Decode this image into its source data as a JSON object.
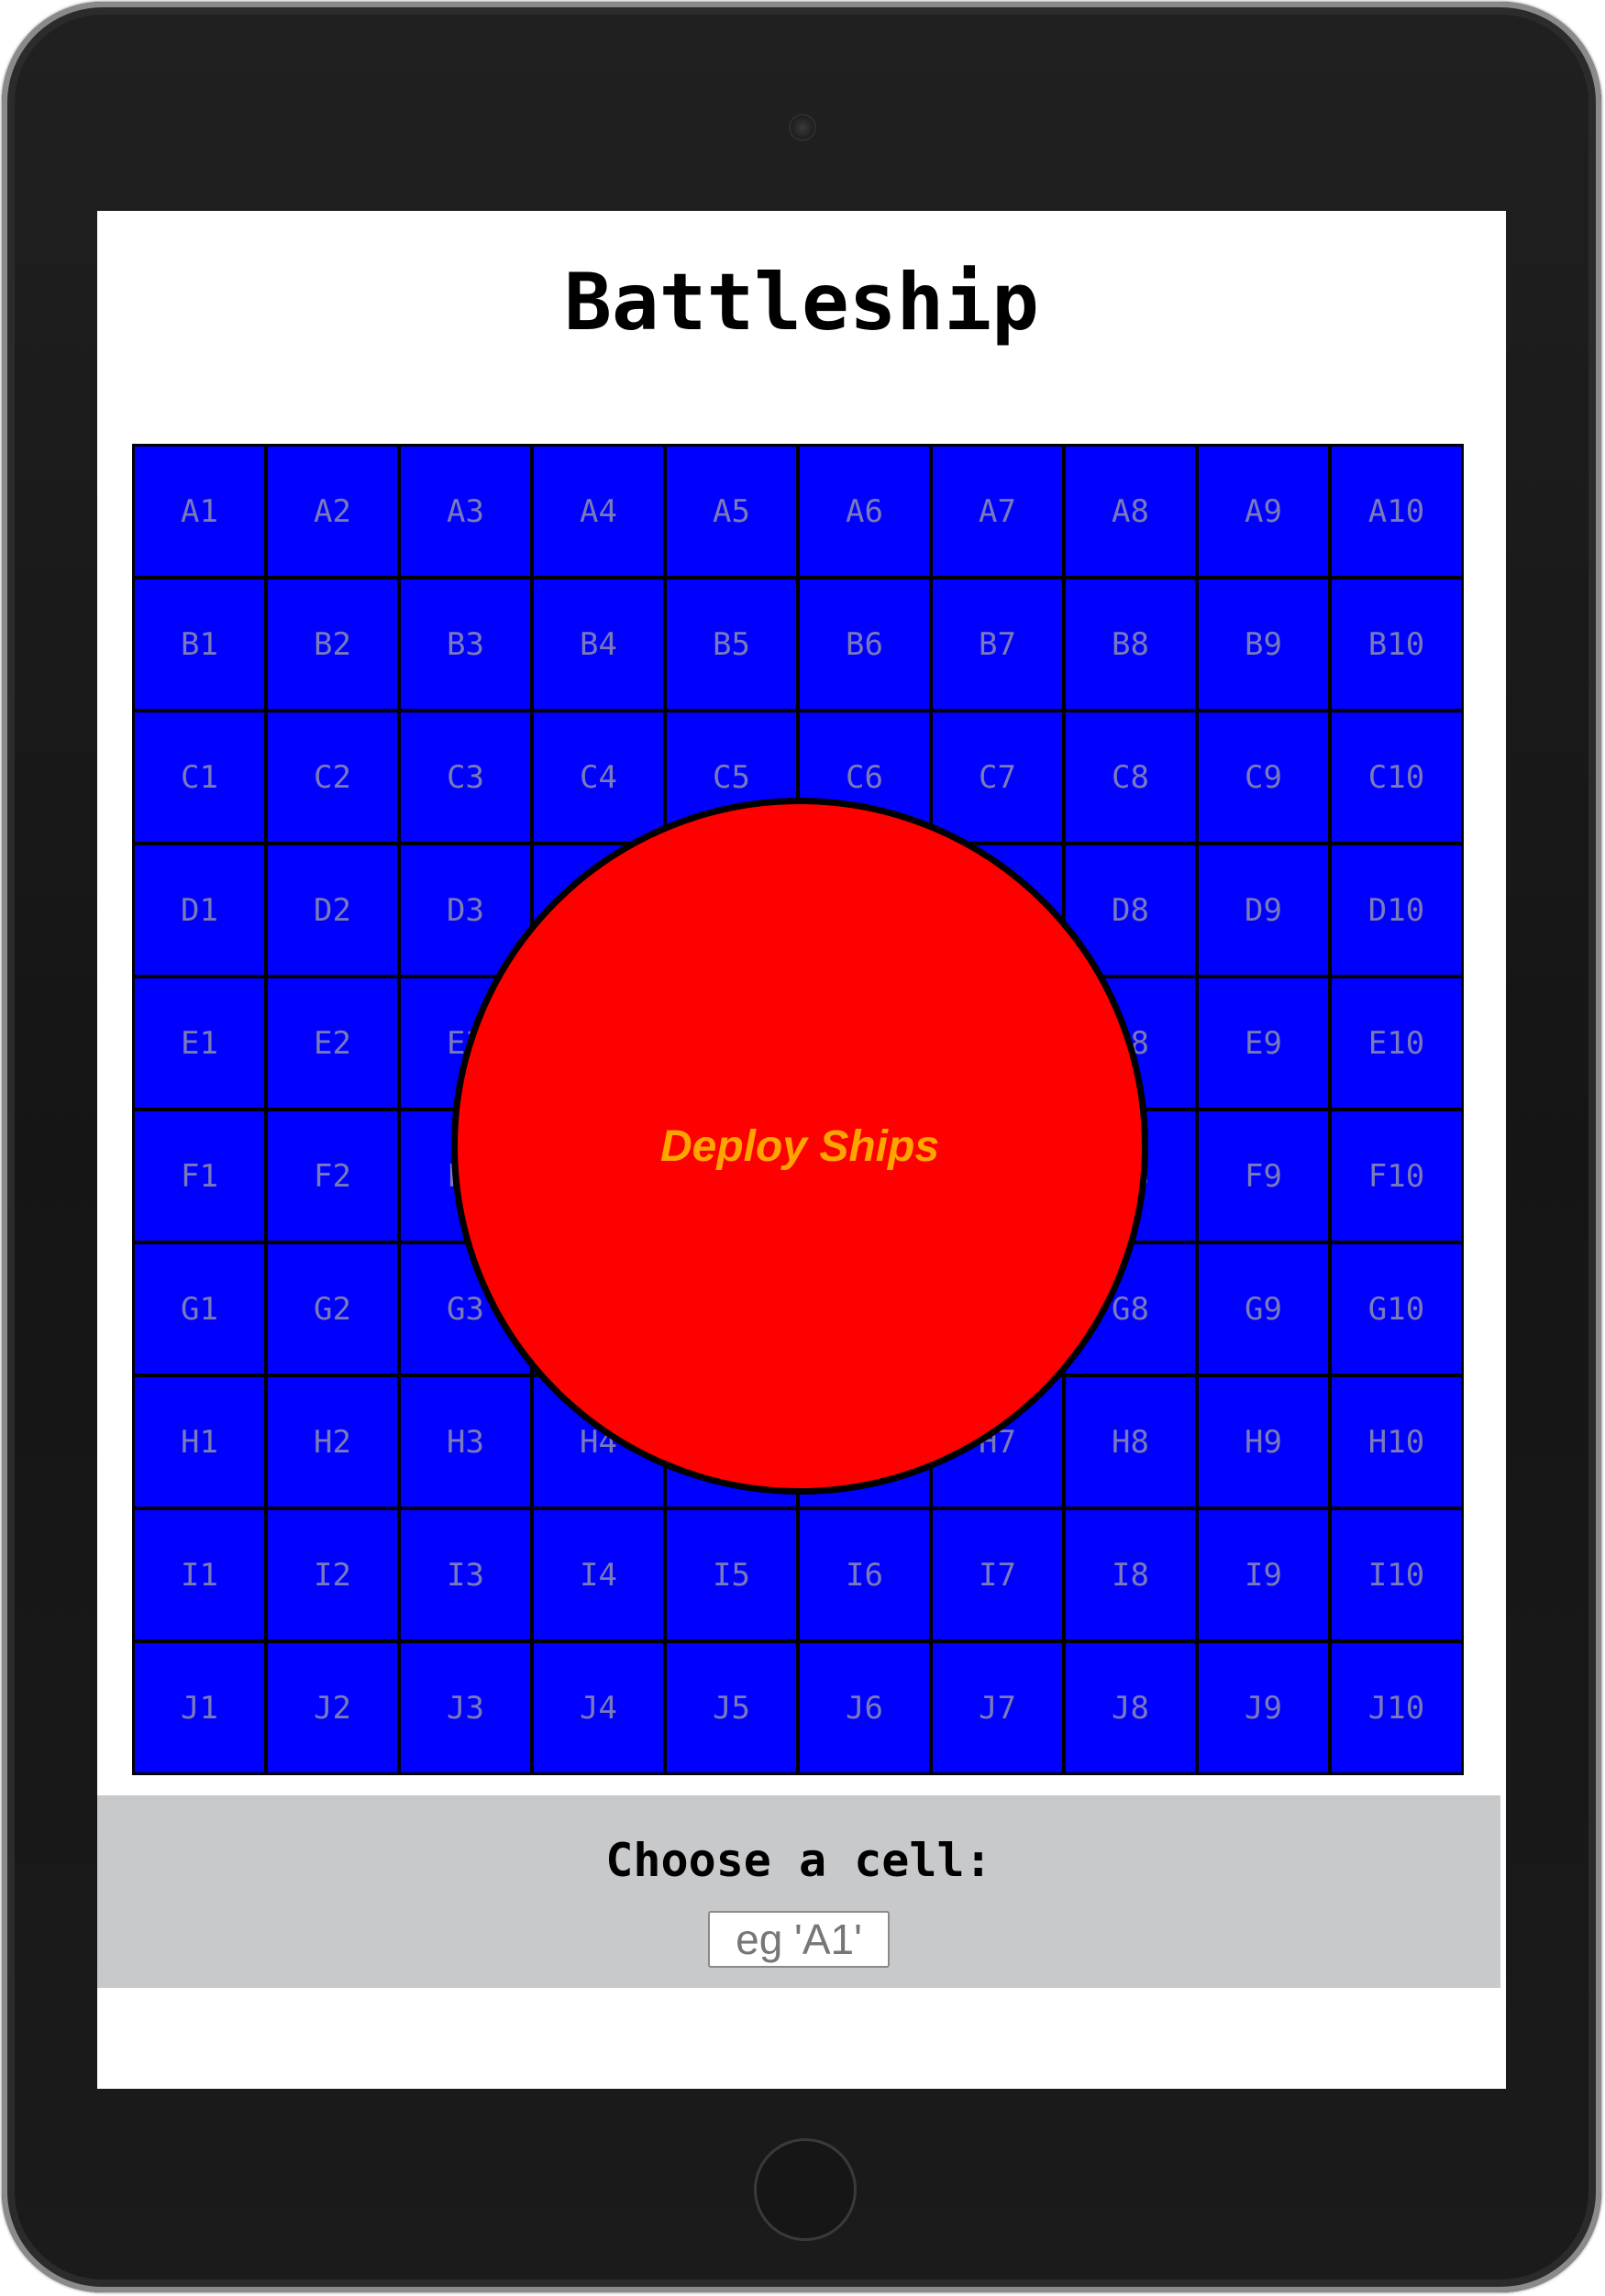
{
  "page": {
    "title": "Battleship"
  },
  "board": {
    "rows": [
      "A",
      "B",
      "C",
      "D",
      "E",
      "F",
      "G",
      "H",
      "I",
      "J"
    ],
    "columns": [
      "1",
      "2",
      "3",
      "4",
      "5",
      "6",
      "7",
      "8",
      "9",
      "10"
    ],
    "cell_color": "#0000ff",
    "grid_line_color": "#000000"
  },
  "overlay": {
    "deploy_label": "Deploy Ships",
    "circle_color": "#ff0000",
    "label_color": "#ffa500"
  },
  "controls": {
    "prompt": "Choose a cell:",
    "input_placeholder": "eg 'A1'",
    "panel_color": "#c8c9cb"
  }
}
